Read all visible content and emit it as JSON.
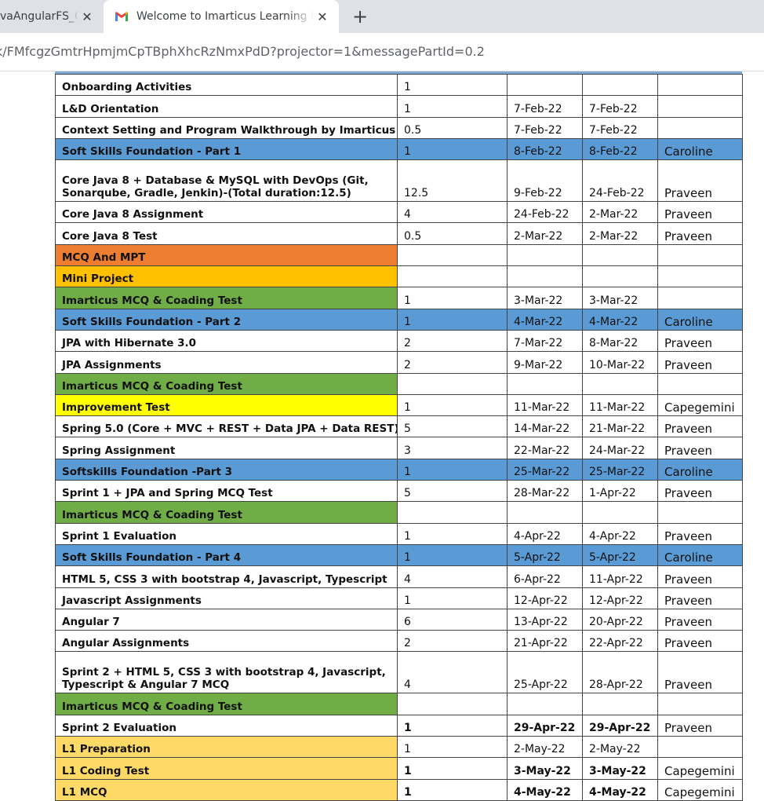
{
  "browser": {
    "tabs": [
      {
        "title": "vaAngularFS_C",
        "close": "✕"
      },
      {
        "title": "Welcome to Imarticus Learning P",
        "close": "✕"
      }
    ],
    "new_tab": "+",
    "url": "k/FMfcgzGmtrHpmjmCpTBphXhcRzNmxPdD?projector=1&messagePartId=0.2"
  },
  "colors": {
    "blue": "#5b9bd5",
    "orange": "#ed7d31",
    "amber": "#ffc000",
    "green": "#70ad47",
    "yellow": "#ffff00",
    "peach": "#ffd966"
  },
  "schedule": {
    "rows": [
      {
        "activity": "Onboarding Activities",
        "days": "1",
        "start": "",
        "end": "",
        "trainer": ""
      },
      {
        "activity": "L&D Orientation",
        "days": "1",
        "start": "7-Feb-22",
        "end": "7-Feb-22",
        "trainer": ""
      },
      {
        "activity": "Context Setting and Program Walkthrough by Imarticus Team",
        "days": "0.5",
        "start": "7-Feb-22",
        "end": "7-Feb-22",
        "trainer": ""
      },
      {
        "activity": "Soft Skills Foundation - Part 1",
        "days": "1",
        "start": "8-Feb-22",
        "end": "8-Feb-22",
        "trainer": "Caroline"
      },
      {
        "activity": "Core Java 8 + Database & MySQL with DevOps (Git, Sonarqube, Gradle, Jenkin)-(Total duration:12.5)",
        "days": "12.5",
        "start": "9-Feb-22",
        "end": "24-Feb-22",
        "trainer": "Praveen"
      },
      {
        "activity": "Core Java 8 Assignment",
        "days": "4",
        "start": "24-Feb-22",
        "end": "2-Mar-22",
        "trainer": "Praveen"
      },
      {
        "activity": "Core Java 8 Test",
        "days": "0.5",
        "start": "2-Mar-22",
        "end": "2-Mar-22",
        "trainer": "Praveen"
      },
      {
        "activity": "MCQ And MPT",
        "days": "",
        "start": "",
        "end": "",
        "trainer": ""
      },
      {
        "activity": "Mini Project",
        "days": "",
        "start": "",
        "end": "",
        "trainer": ""
      },
      {
        "activity": "Imarticus MCQ & Coading Test",
        "days": "1",
        "start": "3-Mar-22",
        "end": "3-Mar-22",
        "trainer": ""
      },
      {
        "activity": "Soft Skills Foundation - Part 2",
        "days": "1",
        "start": "4-Mar-22",
        "end": "4-Mar-22",
        "trainer": "Caroline"
      },
      {
        "activity": "JPA with Hibernate 3.0",
        "days": "2",
        "start": "7-Mar-22",
        "end": "8-Mar-22",
        "trainer": "Praveen"
      },
      {
        "activity": "JPA Assignments",
        "days": "2",
        "start": "9-Mar-22",
        "end": "10-Mar-22",
        "trainer": "Praveen"
      },
      {
        "activity": "Imarticus MCQ & Coading Test",
        "days": "",
        "start": "",
        "end": "",
        "trainer": ""
      },
      {
        "activity": "Improvement Test",
        "days": "1",
        "start": "11-Mar-22",
        "end": "11-Mar-22",
        "trainer": "Capegemini"
      },
      {
        "activity": "Spring 5.0 (Core + MVC + REST + Data JPA + Data REST)",
        "days": "5",
        "start": "14-Mar-22",
        "end": "21-Mar-22",
        "trainer": "Praveen"
      },
      {
        "activity": "Spring Assignment",
        "days": "3",
        "start": "22-Mar-22",
        "end": "24-Mar-22",
        "trainer": "Praveen"
      },
      {
        "activity": "Softskills Foundation -Part 3",
        "days": "1",
        "start": "25-Mar-22",
        "end": "25-Mar-22",
        "trainer": "Caroline"
      },
      {
        "activity": "Sprint 1 + JPA and Spring MCQ Test",
        "days": "5",
        "start": "28-Mar-22",
        "end": "1-Apr-22",
        "trainer": "Praveen"
      },
      {
        "activity": "Imarticus MCQ & Coading Test",
        "days": "",
        "start": "",
        "end": "",
        "trainer": ""
      },
      {
        "activity": "Sprint 1 Evaluation",
        "days": "1",
        "start": "4-Apr-22",
        "end": "4-Apr-22",
        "trainer": "Praveen"
      },
      {
        "activity": "Soft Skills Foundation - Part 4",
        "days": "1",
        "start": "5-Apr-22",
        "end": "5-Apr-22",
        "trainer": "Caroline"
      },
      {
        "activity": "HTML 5, CSS 3 with bootstrap 4, Javascript, Typescript",
        "days": "4",
        "start": "6-Apr-22",
        "end": "11-Apr-22",
        "trainer": "Praveen"
      },
      {
        "activity": "Javascript Assignments",
        "days": "1",
        "start": "12-Apr-22",
        "end": "12-Apr-22",
        "trainer": "Praveen"
      },
      {
        "activity": "Angular 7",
        "days": "6",
        "start": "13-Apr-22",
        "end": "20-Apr-22",
        "trainer": "Praveen"
      },
      {
        "activity": "Angular Assignments",
        "days": "2",
        "start": "21-Apr-22",
        "end": "22-Apr-22",
        "trainer": "Praveen"
      },
      {
        "activity": "Sprint 2 + HTML 5, CSS 3 with bootstrap 4, Javascript, Typescript & Angular 7 MCQ",
        "days": "4",
        "start": "25-Apr-22",
        "end": "28-Apr-22",
        "trainer": "Praveen"
      },
      {
        "activity": "Imarticus MCQ & Coading Test",
        "days": "",
        "start": "",
        "end": "",
        "trainer": ""
      },
      {
        "activity": "Sprint 2 Evaluation",
        "days": "1",
        "start": "29-Apr-22",
        "end": "29-Apr-22",
        "trainer": "Praveen"
      },
      {
        "activity": "L1 Preparation",
        "days": "1",
        "start": "2-May-22",
        "end": "2-May-22",
        "trainer": ""
      },
      {
        "activity": "L1 Coding Test",
        "days": "1",
        "start": "3-May-22",
        "end": "3-May-22",
        "trainer": "Capegemini"
      },
      {
        "activity": "L1 MCQ",
        "days": "1",
        "start": "4-May-22",
        "end": "4-May-22",
        "trainer": "Capegemini"
      }
    ]
  }
}
